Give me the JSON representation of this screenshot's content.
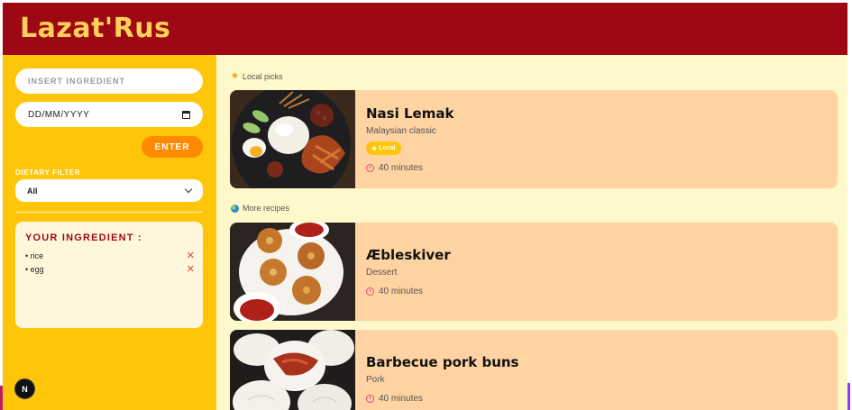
{
  "app": {
    "title": "Lazat'Rus"
  },
  "sidebar": {
    "ingredient_placeholder": "INSERT INGREDIENT",
    "date_placeholder": "DD/MM/YYYY",
    "enter_label": "ENTER",
    "filter_label": "DIETARY FILTER",
    "filter_selected": "All",
    "ingredients_heading": "YOUR INGREDIENT :",
    "ingredients": [
      {
        "label": "• rice",
        "remove": "✕"
      },
      {
        "label": "• egg",
        "remove": "✕"
      }
    ],
    "badge_letter": "N"
  },
  "main": {
    "local_section_label": "Local picks",
    "more_section_label": "More recipes",
    "recipes": [
      {
        "title": "Nasi Lemak",
        "subtitle": "Malaysian classic",
        "badge": "Local",
        "time": "40 minutes"
      },
      {
        "title": "Æbleskiver",
        "subtitle": "Dessert",
        "time": "40 minutes"
      },
      {
        "title": "Barbecue pork buns",
        "subtitle": "Pork",
        "time": "40 minutes"
      }
    ]
  },
  "colors": {
    "header": "#9e0812",
    "title": "#ffd15c",
    "sidebar": "#fec509",
    "main_bg": "#fff8ca",
    "card": "#ffd3a2",
    "enter_button": "#ff8a00"
  },
  "icons": {
    "local": "star-icon",
    "more": "globe-icon",
    "time": "clock-icon",
    "remove": "close-icon",
    "date": "calendar-icon",
    "select": "chevron-down-icon"
  }
}
